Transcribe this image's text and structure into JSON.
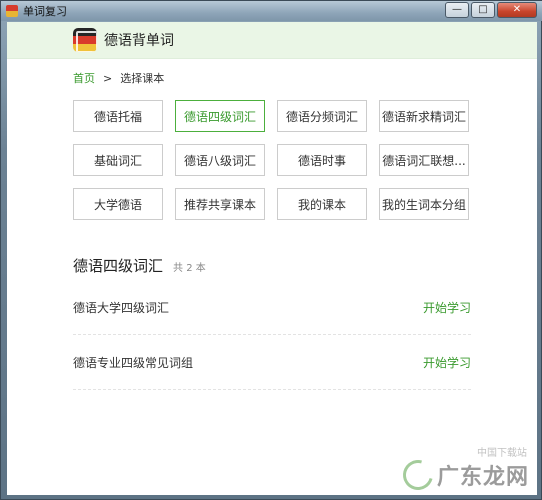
{
  "window": {
    "title": "单词复习",
    "controls": {
      "minimize": "—",
      "maximize": "□",
      "close": "✕"
    }
  },
  "app": {
    "title": "德语背单词"
  },
  "breadcrumb": {
    "home": "首页",
    "separator": ">",
    "current": "选择课本"
  },
  "tiles": [
    {
      "label": "德语托福",
      "active": false
    },
    {
      "label": "德语四级词汇",
      "active": true
    },
    {
      "label": "德语分频词汇",
      "active": false
    },
    {
      "label": "德语新求精词汇",
      "active": false
    },
    {
      "label": "基础词汇",
      "active": false
    },
    {
      "label": "德语八级词汇",
      "active": false
    },
    {
      "label": "德语时事",
      "active": false
    },
    {
      "label": "德语词汇联想...",
      "active": false
    },
    {
      "label": "大学德语",
      "active": false
    },
    {
      "label": "推荐共享课本",
      "active": false
    },
    {
      "label": "我的课本",
      "active": false
    },
    {
      "label": "我的生词本分组",
      "active": false
    }
  ],
  "section": {
    "title": "德语四级词汇",
    "count": "共 2 本"
  },
  "courses": [
    {
      "name": "德语大学四级词汇",
      "action": "开始学习"
    },
    {
      "name": "德语专业四级常见词组",
      "action": "开始学习"
    }
  ],
  "watermark": {
    "text": "广东龙网",
    "sub": "中国下载站"
  },
  "colors": {
    "accent": "#3a9a2e",
    "header_bg": "#eaf6e6",
    "active_border": "#4caf3d"
  }
}
